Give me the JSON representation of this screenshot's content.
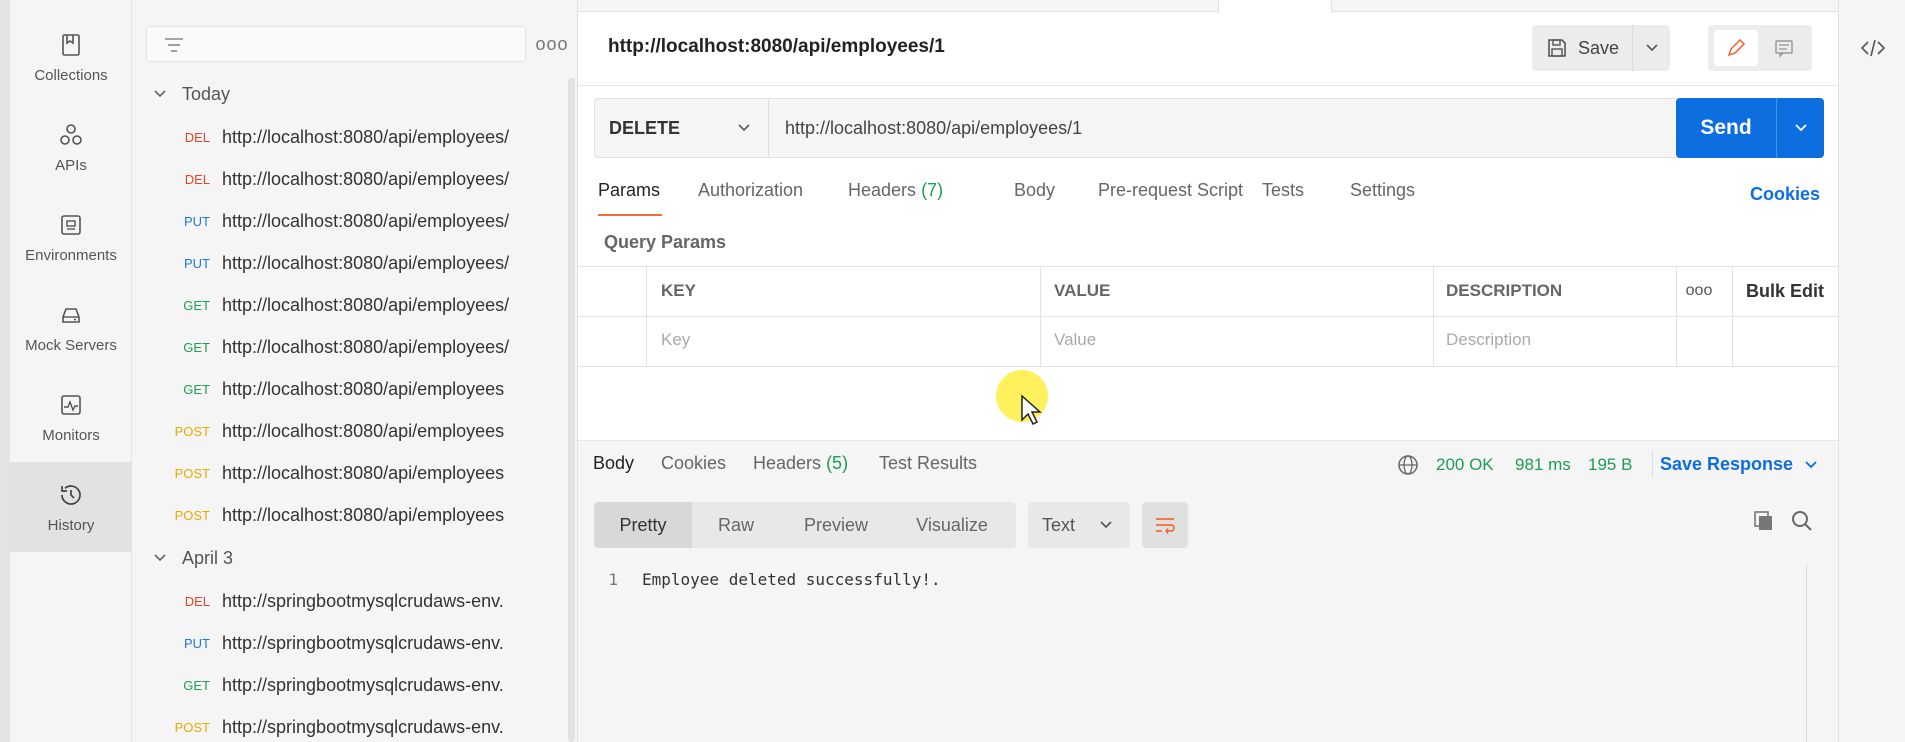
{
  "rail": {
    "items": [
      {
        "label": "Collections",
        "icon": "collections-icon"
      },
      {
        "label": "APIs",
        "icon": "apis-icon"
      },
      {
        "label": "Environments",
        "icon": "environments-icon"
      },
      {
        "label": "Mock Servers",
        "icon": "mock-servers-icon"
      },
      {
        "label": "Monitors",
        "icon": "monitors-icon"
      },
      {
        "label": "History",
        "icon": "history-icon",
        "active": true
      }
    ]
  },
  "sidebar": {
    "more": "ooo",
    "groups": [
      {
        "label": "Today",
        "items": [
          {
            "method": "DEL",
            "url": "http://localhost:8080/api/employees/"
          },
          {
            "method": "DEL",
            "url": "http://localhost:8080/api/employees/"
          },
          {
            "method": "PUT",
            "url": "http://localhost:8080/api/employees/"
          },
          {
            "method": "PUT",
            "url": "http://localhost:8080/api/employees/"
          },
          {
            "method": "GET",
            "url": "http://localhost:8080/api/employees/"
          },
          {
            "method": "GET",
            "url": "http://localhost:8080/api/employees/"
          },
          {
            "method": "GET",
            "url": "http://localhost:8080/api/employees"
          },
          {
            "method": "POST",
            "url": "http://localhost:8080/api/employees"
          },
          {
            "method": "POST",
            "url": "http://localhost:8080/api/employees"
          },
          {
            "method": "POST",
            "url": "http://localhost:8080/api/employees"
          }
        ]
      },
      {
        "label": "April 3",
        "items": [
          {
            "method": "DEL",
            "url": "http://springbootmysqlcrudaws-env."
          },
          {
            "method": "PUT",
            "url": "http://springbootmysqlcrudaws-env."
          },
          {
            "method": "GET",
            "url": "http://springbootmysqlcrudaws-env."
          },
          {
            "method": "POST",
            "url": "http://springbootmysqlcrudaws-env."
          }
        ]
      }
    ]
  },
  "method_colors": {
    "DEL": "#e0442b",
    "PUT": "#1f79d6",
    "GET": "#1e9d55",
    "POST": "#e8a900"
  },
  "request": {
    "title": "http://localhost:8080/api/employees/1",
    "save_label": "Save",
    "method": "DELETE",
    "url": "http://localhost:8080/api/employees/1",
    "send_label": "Send",
    "tabs": [
      {
        "label": "Params",
        "active": true
      },
      {
        "label": "Authorization"
      },
      {
        "label": "Headers",
        "count": "(7)"
      },
      {
        "label": "Body"
      },
      {
        "label": "Pre-request Script"
      },
      {
        "label": "Tests"
      },
      {
        "label": "Settings"
      }
    ],
    "cookies_label": "Cookies"
  },
  "query_params": {
    "title": "Query Params",
    "headers": {
      "key": "KEY",
      "value": "VALUE",
      "description": "DESCRIPTION"
    },
    "placeholders": {
      "key": "Key",
      "value": "Value",
      "description": "Description"
    },
    "bulk_edit": "Bulk Edit",
    "more": "ooo"
  },
  "response": {
    "tabs": [
      {
        "label": "Body",
        "active": true
      },
      {
        "label": "Cookies"
      },
      {
        "label": "Headers",
        "count": "(5)"
      },
      {
        "label": "Test Results"
      }
    ],
    "status": "200 OK",
    "time": "981 ms",
    "size": "195 B",
    "save_response": "Save Response",
    "views": [
      "Pretty",
      "Raw",
      "Preview",
      "Visualize"
    ],
    "active_view": "Pretty",
    "format": "Text",
    "lines": [
      {
        "num": "1",
        "text": "Employee deleted successfully!."
      }
    ]
  },
  "colors": {
    "accent": "#0d6ee0",
    "tab_underline": "#f06d3a",
    "success": "#1e9d55"
  }
}
